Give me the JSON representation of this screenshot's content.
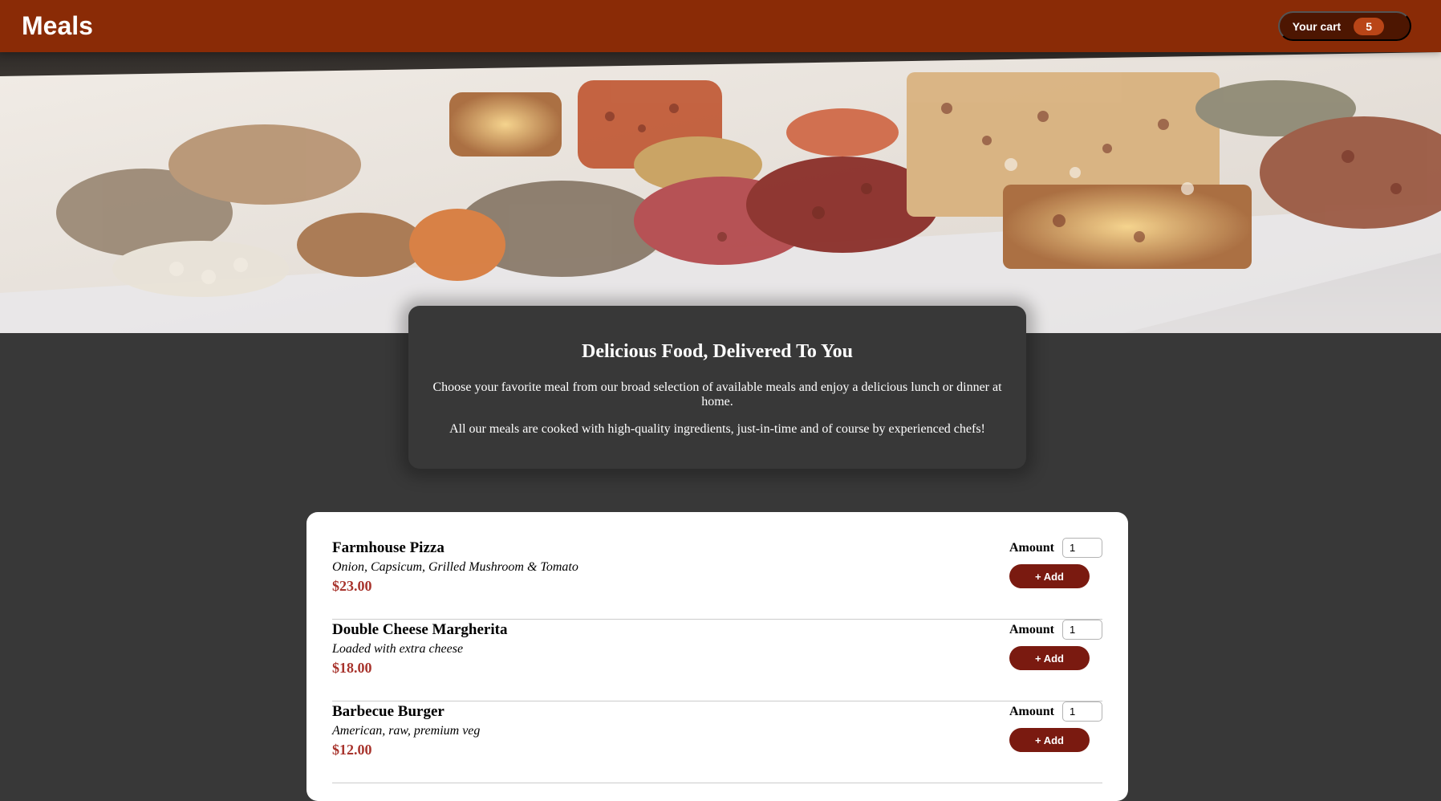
{
  "header": {
    "title": "Meals",
    "cart_label": "Your cart",
    "cart_count": "5"
  },
  "summary": {
    "heading": "Delicious Food, Delivered To You",
    "paragraph1": "Choose your favorite meal from our broad selection of available meals and enjoy a delicious lunch or dinner at home.",
    "paragraph2": "All our meals are cooked with high-quality ingredients, just-in-time and of course by experienced chefs!"
  },
  "meals": [
    {
      "name": "Farmhouse Pizza",
      "description": "Onion, Capsicum, Grilled Mushroom & Tomato",
      "price": "$23.00",
      "amount_label": "Amount",
      "amount_value": "1",
      "add_label": "+ Add"
    },
    {
      "name": "Double Cheese Margherita",
      "description": "Loaded with extra cheese",
      "price": "$18.00",
      "amount_label": "Amount",
      "amount_value": "1",
      "add_label": "+ Add"
    },
    {
      "name": "Barbecue Burger",
      "description": "American, raw, premium veg",
      "price": "$12.00",
      "amount_label": "Amount",
      "amount_value": "1",
      "add_label": "+ Add"
    }
  ],
  "colors": {
    "header_bg": "#8a2b06",
    "cart_bg": "#4d1601",
    "cart_badge": "#b94517",
    "page_bg": "#383838",
    "price": "#a8342d",
    "add_button": "#7a1a10"
  }
}
